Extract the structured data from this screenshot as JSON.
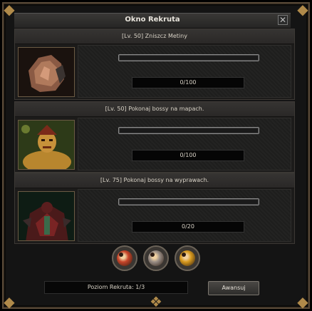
{
  "window": {
    "title": "Okno Rekruta",
    "close_glyph": "✕"
  },
  "quests": [
    {
      "header": "[Lv. 50] Zniszcz Metiny",
      "progress_text": "0/100",
      "progress_fraction": 0,
      "portrait_icon": "metin-stone-icon"
    },
    {
      "header": "[Lv. 50] Pokonaj bossy na mapach.",
      "progress_text": "0/100",
      "progress_fraction": 0,
      "portrait_icon": "boss-warrior-icon"
    },
    {
      "header": "[Lv. 75] Pokonaj bossy na wyprawach.",
      "progress_text": "0/20",
      "progress_fraction": 0,
      "portrait_icon": "dungeon-boss-icon"
    }
  ],
  "medals": [
    {
      "name": "bronze-medal-icon",
      "color": "#c8452a"
    },
    {
      "name": "silver-medal-icon",
      "color": "#9a8e86"
    },
    {
      "name": "gold-medal-icon",
      "color": "#d89a1e"
    }
  ],
  "footer": {
    "level_text": "Poziom Rekruta: 1/3",
    "advance_label": "Awansuj"
  },
  "colors": {
    "frame": "#5a4a38",
    "accent_gold": "#b08a4a"
  }
}
